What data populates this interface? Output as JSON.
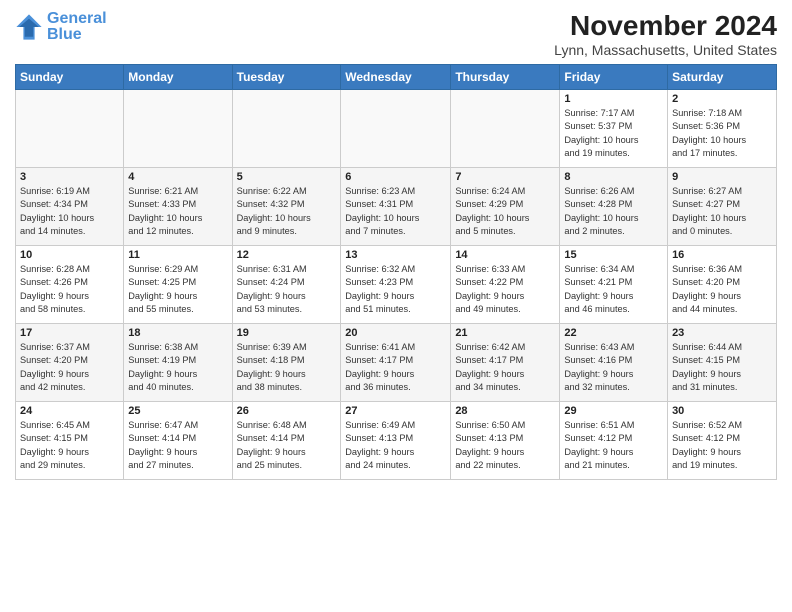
{
  "header": {
    "logo_line1": "General",
    "logo_line2": "Blue",
    "month_title": "November 2024",
    "location": "Lynn, Massachusetts, United States"
  },
  "weekdays": [
    "Sunday",
    "Monday",
    "Tuesday",
    "Wednesday",
    "Thursday",
    "Friday",
    "Saturday"
  ],
  "weeks": [
    [
      {
        "day": "",
        "info": ""
      },
      {
        "day": "",
        "info": ""
      },
      {
        "day": "",
        "info": ""
      },
      {
        "day": "",
        "info": ""
      },
      {
        "day": "",
        "info": ""
      },
      {
        "day": "1",
        "info": "Sunrise: 7:17 AM\nSunset: 5:37 PM\nDaylight: 10 hours\nand 19 minutes."
      },
      {
        "day": "2",
        "info": "Sunrise: 7:18 AM\nSunset: 5:36 PM\nDaylight: 10 hours\nand 17 minutes."
      }
    ],
    [
      {
        "day": "3",
        "info": "Sunrise: 6:19 AM\nSunset: 4:34 PM\nDaylight: 10 hours\nand 14 minutes."
      },
      {
        "day": "4",
        "info": "Sunrise: 6:21 AM\nSunset: 4:33 PM\nDaylight: 10 hours\nand 12 minutes."
      },
      {
        "day": "5",
        "info": "Sunrise: 6:22 AM\nSunset: 4:32 PM\nDaylight: 10 hours\nand 9 minutes."
      },
      {
        "day": "6",
        "info": "Sunrise: 6:23 AM\nSunset: 4:31 PM\nDaylight: 10 hours\nand 7 minutes."
      },
      {
        "day": "7",
        "info": "Sunrise: 6:24 AM\nSunset: 4:29 PM\nDaylight: 10 hours\nand 5 minutes."
      },
      {
        "day": "8",
        "info": "Sunrise: 6:26 AM\nSunset: 4:28 PM\nDaylight: 10 hours\nand 2 minutes."
      },
      {
        "day": "9",
        "info": "Sunrise: 6:27 AM\nSunset: 4:27 PM\nDaylight: 10 hours\nand 0 minutes."
      }
    ],
    [
      {
        "day": "10",
        "info": "Sunrise: 6:28 AM\nSunset: 4:26 PM\nDaylight: 9 hours\nand 58 minutes."
      },
      {
        "day": "11",
        "info": "Sunrise: 6:29 AM\nSunset: 4:25 PM\nDaylight: 9 hours\nand 55 minutes."
      },
      {
        "day": "12",
        "info": "Sunrise: 6:31 AM\nSunset: 4:24 PM\nDaylight: 9 hours\nand 53 minutes."
      },
      {
        "day": "13",
        "info": "Sunrise: 6:32 AM\nSunset: 4:23 PM\nDaylight: 9 hours\nand 51 minutes."
      },
      {
        "day": "14",
        "info": "Sunrise: 6:33 AM\nSunset: 4:22 PM\nDaylight: 9 hours\nand 49 minutes."
      },
      {
        "day": "15",
        "info": "Sunrise: 6:34 AM\nSunset: 4:21 PM\nDaylight: 9 hours\nand 46 minutes."
      },
      {
        "day": "16",
        "info": "Sunrise: 6:36 AM\nSunset: 4:20 PM\nDaylight: 9 hours\nand 44 minutes."
      }
    ],
    [
      {
        "day": "17",
        "info": "Sunrise: 6:37 AM\nSunset: 4:20 PM\nDaylight: 9 hours\nand 42 minutes."
      },
      {
        "day": "18",
        "info": "Sunrise: 6:38 AM\nSunset: 4:19 PM\nDaylight: 9 hours\nand 40 minutes."
      },
      {
        "day": "19",
        "info": "Sunrise: 6:39 AM\nSunset: 4:18 PM\nDaylight: 9 hours\nand 38 minutes."
      },
      {
        "day": "20",
        "info": "Sunrise: 6:41 AM\nSunset: 4:17 PM\nDaylight: 9 hours\nand 36 minutes."
      },
      {
        "day": "21",
        "info": "Sunrise: 6:42 AM\nSunset: 4:17 PM\nDaylight: 9 hours\nand 34 minutes."
      },
      {
        "day": "22",
        "info": "Sunrise: 6:43 AM\nSunset: 4:16 PM\nDaylight: 9 hours\nand 32 minutes."
      },
      {
        "day": "23",
        "info": "Sunrise: 6:44 AM\nSunset: 4:15 PM\nDaylight: 9 hours\nand 31 minutes."
      }
    ],
    [
      {
        "day": "24",
        "info": "Sunrise: 6:45 AM\nSunset: 4:15 PM\nDaylight: 9 hours\nand 29 minutes."
      },
      {
        "day": "25",
        "info": "Sunrise: 6:47 AM\nSunset: 4:14 PM\nDaylight: 9 hours\nand 27 minutes."
      },
      {
        "day": "26",
        "info": "Sunrise: 6:48 AM\nSunset: 4:14 PM\nDaylight: 9 hours\nand 25 minutes."
      },
      {
        "day": "27",
        "info": "Sunrise: 6:49 AM\nSunset: 4:13 PM\nDaylight: 9 hours\nand 24 minutes."
      },
      {
        "day": "28",
        "info": "Sunrise: 6:50 AM\nSunset: 4:13 PM\nDaylight: 9 hours\nand 22 minutes."
      },
      {
        "day": "29",
        "info": "Sunrise: 6:51 AM\nSunset: 4:12 PM\nDaylight: 9 hours\nand 21 minutes."
      },
      {
        "day": "30",
        "info": "Sunrise: 6:52 AM\nSunset: 4:12 PM\nDaylight: 9 hours\nand 19 minutes."
      }
    ]
  ]
}
